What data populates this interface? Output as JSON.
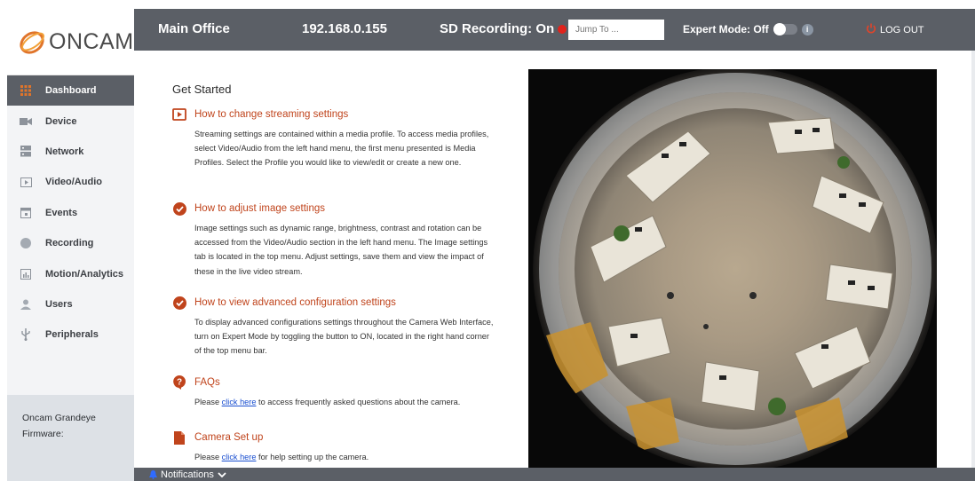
{
  "brand": {
    "logo_text": "ONCAM"
  },
  "topbar": {
    "site_name": "Main Office",
    "ip_address": "192.168.0.155",
    "sd_recording": "SD Recording: On",
    "jump_placeholder": "Jump To ...",
    "expert_mode": "Expert Mode: Off",
    "info_glyph": "i",
    "logout": "LOG OUT"
  },
  "sidebar": {
    "items": [
      {
        "label": "Dashboard",
        "icon": "grid-icon",
        "active": true
      },
      {
        "label": "Device",
        "icon": "camera-icon",
        "active": false
      },
      {
        "label": "Network",
        "icon": "server-icon",
        "active": false
      },
      {
        "label": "Video/Audio",
        "icon": "play-icon",
        "active": false
      },
      {
        "label": "Events",
        "icon": "calendar-icon",
        "active": false
      },
      {
        "label": "Recording",
        "icon": "record-icon",
        "active": false
      },
      {
        "label": "Motion/Analytics",
        "icon": "chart-icon",
        "active": false
      },
      {
        "label": "Users",
        "icon": "user-icon",
        "active": false
      },
      {
        "label": "Peripherals",
        "icon": "usb-icon",
        "active": false
      }
    ],
    "firmware_line1": "Oncam Grandeye",
    "firmware_line2": "Firmware:"
  },
  "main": {
    "title": "Get Started",
    "sections": [
      {
        "icon": "video-play-icon",
        "title": "How to change streaming settings",
        "body": "Streaming settings are contained within a media profile. To access media profiles, select Video/Audio from the left hand menu, the first menu presented is Media Profiles. Select the Profile you would like to view/edit or create a new one."
      },
      {
        "icon": "check-circle-icon",
        "title": "How to adjust image settings",
        "body": "Image settings such as dynamic range, brightness, contrast and rotation can be accessed from the Video/Audio section in the left hand menu. The Image settings tab is located in the top menu. Adjust settings, save them and view the impact of these in the live video stream."
      },
      {
        "icon": "check-circle-icon",
        "title": "How to view advanced configuration settings",
        "body": "To display advanced configurations settings throughout the Camera Web Interface, turn on Expert Mode by toggling the button to ON, located in the right hand corner of the top menu bar."
      },
      {
        "icon": "question-circle-icon",
        "title": "FAQs",
        "body_before": "Please ",
        "link": "click here",
        "body_after": " to access frequently asked questions about the camera."
      },
      {
        "icon": "document-icon",
        "title": "Camera Set up",
        "body_before": "Please ",
        "link": "click here",
        "body_after": " for help setting up the camera."
      }
    ]
  },
  "footer": {
    "notifications": "Notifications"
  },
  "colors": {
    "topbar": "#5b5f66",
    "accent": "#c0441c",
    "recording": "#e0231c",
    "link": "#1a4fd0",
    "logo_mark": "#e0742a"
  }
}
